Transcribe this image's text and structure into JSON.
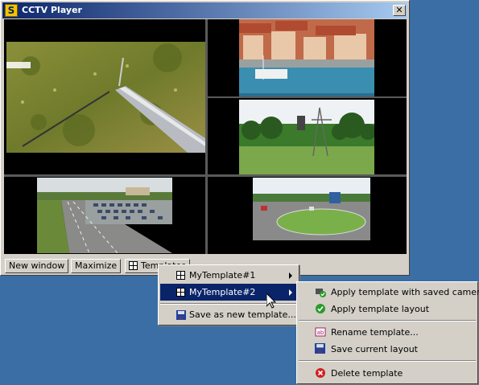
{
  "window": {
    "title": "CCTV Player",
    "close_glyph": "✕"
  },
  "cameras": [
    {
      "name": "camera-grass-pole"
    },
    {
      "name": "camera-harbor"
    },
    {
      "name": "camera-field-tower"
    },
    {
      "name": "camera-highway-parking"
    },
    {
      "name": "camera-roundabout"
    }
  ],
  "toolbar": {
    "new_window": "New window",
    "maximize": "Maximize",
    "templates": "Templates"
  },
  "templates_menu": {
    "items": [
      {
        "label": "MyTemplate#1",
        "icon": "grid-icon"
      },
      {
        "label": "MyTemplate#2",
        "icon": "grid-icon"
      },
      {
        "label": "Save as new template...",
        "icon": "floppy-disk-icon"
      }
    ]
  },
  "template_submenu": {
    "items": [
      {
        "label": "Apply template with saved cameras",
        "icon": "camera-check-icon"
      },
      {
        "label": "Apply template layout",
        "icon": "green-check-icon"
      },
      {
        "label": "Rename template...",
        "icon": "rename-icon"
      },
      {
        "label": "Save current layout",
        "icon": "floppy-disk-icon"
      },
      {
        "label": "Delete template",
        "icon": "red-delete-icon"
      }
    ]
  },
  "colors": {
    "titlebar_start": "#0a246a",
    "titlebar_end": "#a6caf0",
    "selection": "#0a246a",
    "desktop": "#3a6ea5"
  }
}
